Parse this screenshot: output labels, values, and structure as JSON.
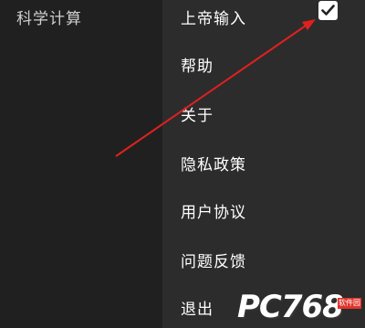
{
  "left_panel": {
    "title": "科学计算"
  },
  "menu": {
    "items": [
      {
        "label": "上帝输入",
        "checked": true
      },
      {
        "label": "帮助"
      },
      {
        "label": "关于"
      },
      {
        "label": "隐私政策"
      },
      {
        "label": "用户协议"
      },
      {
        "label": "问题反馈"
      },
      {
        "label": "退出"
      }
    ]
  },
  "watermark": {
    "text": "PC768",
    "badge": "软件园"
  },
  "colors": {
    "background": "#1f1f1f",
    "menu_background": "#2c2c2c",
    "arrow": "#e02020",
    "checkbox": "#ffffff"
  },
  "icons": {
    "checkbox": "checkmark-icon",
    "annotation": "red-arrow-icon"
  }
}
